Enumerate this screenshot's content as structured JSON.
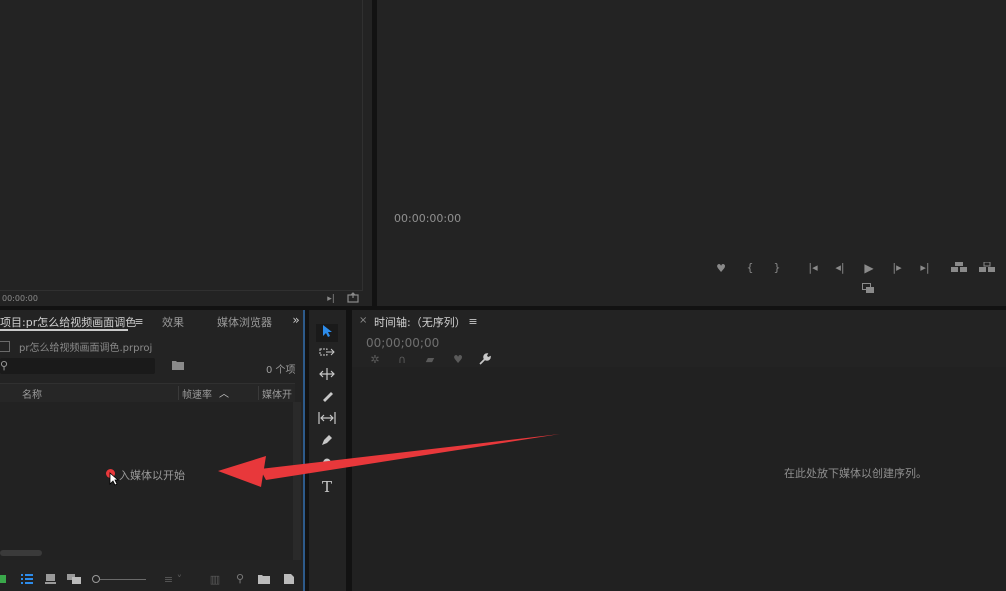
{
  "source_monitor": {
    "timecode": "00:00:00"
  },
  "program_monitor": {
    "timecode": "00:00:00:00",
    "controls": [
      "marker-icon",
      "mark-in-icon",
      "mark-out-icon",
      "go-to-in-icon",
      "step-back-icon",
      "play-icon",
      "step-forward-icon",
      "go-to-out-icon",
      "lift-icon",
      "extract-icon",
      "export-frame-icon"
    ]
  },
  "project_panel": {
    "tab_label": "项目:pr怎么给视频画面调色",
    "tab_effects": "效果",
    "tab_media_browser": "媒体浏览器",
    "project_file": "pr怎么给视频画面调色.prproj",
    "item_count": "0 个项",
    "col_name": "名称",
    "col_framerate": "帧速率",
    "col_media": "媒体开",
    "empty_message": "入媒体以开始"
  },
  "timeline_panel": {
    "tab_label": "时间轴:（无序列）",
    "timecode": "00;00;00;00",
    "drop_hint": "在此处放下媒体以创建序列。"
  },
  "colors": {
    "panel_bg": "#232323",
    "accent_blue": "#2d8ceb",
    "annotation_red": "#e8383b"
  }
}
